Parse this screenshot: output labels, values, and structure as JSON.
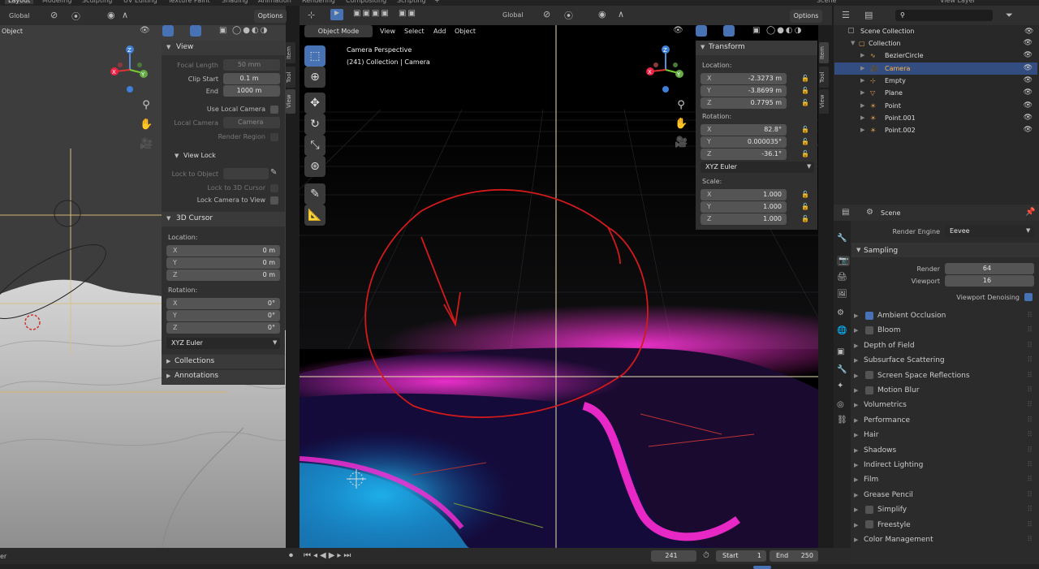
{
  "topbar": {
    "tabs": [
      "Layout",
      "Modeling",
      "Sculpting",
      "UV Editing",
      "Texture Paint",
      "Shading",
      "Animation",
      "Rendering",
      "Compositing",
      "Scripting",
      "+"
    ],
    "scene_label": "Scene",
    "view_layer": "View Layer"
  },
  "left_view": {
    "orientation": "Global",
    "options": "Options",
    "object_label": "Object",
    "view_panel": {
      "title": "View",
      "focal_length_label": "Focal Length",
      "focal_length": "50 mm",
      "clip_start_label": "Clip Start",
      "clip_start": "0.1 m",
      "end_label": "End",
      "end": "1000 m",
      "use_local_camera": "Use Local Camera",
      "local_camera_label": "Local Camera",
      "local_camera_value": "Camera",
      "render_region": "Render Region",
      "view_lock": "View Lock",
      "lock_to_object": "Lock to Object",
      "lock_to_cursor": "Lock to 3D Cursor",
      "lock_camera_to_view": "Lock Camera to View"
    },
    "cursor_panel": {
      "title": "3D Cursor",
      "location_label": "Location:",
      "rotation_label": "Rotation:",
      "loc": [
        {
          "axis": "X",
          "value": "0 m"
        },
        {
          "axis": "Y",
          "value": "0 m"
        },
        {
          "axis": "Z",
          "value": "0 m"
        }
      ],
      "rot": [
        {
          "axis": "X",
          "value": "0°"
        },
        {
          "axis": "Y",
          "value": "0°"
        },
        {
          "axis": "Z",
          "value": "0°"
        }
      ],
      "mode": "XYZ Euler"
    },
    "collections": "Collections",
    "annotations": "Annotations",
    "side_tabs": [
      "Item",
      "Tool",
      "View"
    ]
  },
  "center_view": {
    "orientation": "Global",
    "options": "Options",
    "menu": [
      "Object Mode",
      "View",
      "Select",
      "Add",
      "Object"
    ],
    "overlay_title": "Camera Perspective",
    "overlay_sub": "(241) Collection | Camera",
    "transform": {
      "title": "Transform",
      "location_label": "Location:",
      "rotation_label": "Rotation:",
      "scale_label": "Scale:",
      "loc": [
        {
          "axis": "X",
          "value": "-2.3273 m"
        },
        {
          "axis": "Y",
          "value": "-3.8699 m"
        },
        {
          "axis": "Z",
          "value": "0.7795 m"
        }
      ],
      "rot": [
        {
          "axis": "X",
          "value": "82.8°"
        },
        {
          "axis": "Y",
          "value": "0.000035°"
        },
        {
          "axis": "Z",
          "value": "-36.1°"
        }
      ],
      "mode": "XYZ Euler",
      "scale": [
        {
          "axis": "X",
          "value": "1.000"
        },
        {
          "axis": "Y",
          "value": "1.000"
        },
        {
          "axis": "Z",
          "value": "1.000"
        }
      ]
    },
    "side_tabs": [
      "Item",
      "Tool",
      "View"
    ]
  },
  "outliner": {
    "scene_collection": "Scene Collection",
    "items": [
      {
        "name": "Collection",
        "indent": 1,
        "icon": "collection-icon"
      },
      {
        "name": "BezierCircle",
        "indent": 2,
        "icon": "curve-icon"
      },
      {
        "name": "Camera",
        "indent": 2,
        "icon": "camera-icon",
        "selected": true
      },
      {
        "name": "Empty",
        "indent": 2,
        "icon": "empty-icon"
      },
      {
        "name": "Plane",
        "indent": 2,
        "icon": "mesh-icon"
      },
      {
        "name": "Point",
        "indent": 2,
        "icon": "light-icon"
      },
      {
        "name": "Point.001",
        "indent": 2,
        "icon": "light-icon"
      },
      {
        "name": "Point.002",
        "indent": 2,
        "icon": "light-icon"
      }
    ]
  },
  "properties": {
    "context": "Scene",
    "render_engine_label": "Render Engine",
    "render_engine": "Eevee",
    "sampling": "Sampling",
    "render_label": "Render",
    "render_value": "64",
    "viewport_label": "Viewport",
    "viewport_value": "16",
    "viewport_denoising": "Viewport Denoising",
    "sections": [
      {
        "name": "Ambient Occlusion",
        "check": true,
        "checked": true
      },
      {
        "name": "Bloom",
        "check": true,
        "checked": false
      },
      {
        "name": "Depth of Field",
        "check": false
      },
      {
        "name": "Subsurface Scattering",
        "check": false
      },
      {
        "name": "Screen Space Reflections",
        "check": true,
        "checked": false
      },
      {
        "name": "Motion Blur",
        "check": true,
        "checked": false
      },
      {
        "name": "Volumetrics",
        "check": false
      },
      {
        "name": "Performance",
        "check": false
      },
      {
        "name": "Hair",
        "check": false
      },
      {
        "name": "Shadows",
        "check": false
      },
      {
        "name": "Indirect Lighting",
        "check": false
      },
      {
        "name": "Film",
        "check": false
      },
      {
        "name": "Grease Pencil",
        "check": false
      },
      {
        "name": "Simplify",
        "check": true,
        "checked": false
      },
      {
        "name": "Freestyle",
        "check": true,
        "checked": false
      },
      {
        "name": "Color Management",
        "check": false
      }
    ]
  },
  "timeline": {
    "left_text": "er",
    "current_frame": "241",
    "start_label": "Start",
    "start": "1",
    "end_label": "End",
    "end": "250"
  },
  "colors": {
    "accent": "#4772b3",
    "magenta": "#ff2bd6",
    "cyan": "#1ec8ff",
    "annotation": "#d21a1a"
  }
}
